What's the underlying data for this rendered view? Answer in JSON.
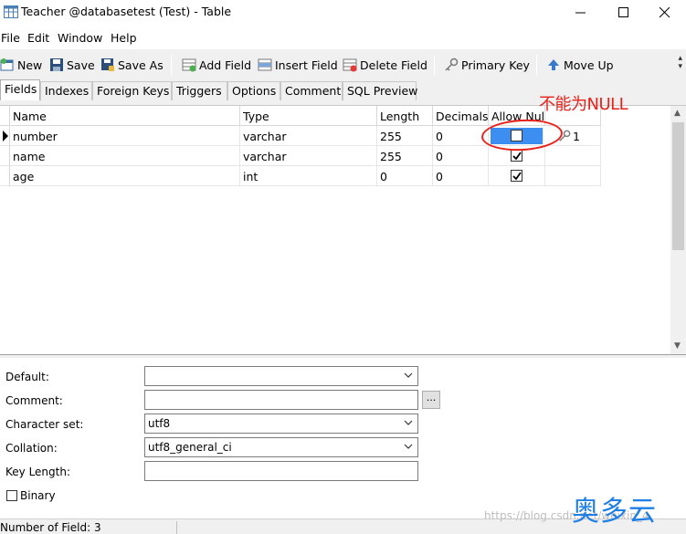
{
  "window": {
    "title": "Teacher @databasetest (Test) - Table"
  },
  "menu": [
    "File",
    "Edit",
    "Window",
    "Help"
  ],
  "toolbar": {
    "new": "New",
    "save": "Save",
    "save_as": "Save As",
    "add_field": "Add Field",
    "insert_field": "Insert Field",
    "delete_field": "Delete Field",
    "primary_key": "Primary Key",
    "move_up": "Move Up"
  },
  "tabs": [
    "Fields",
    "Indexes",
    "Foreign Keys",
    "Triggers",
    "Options",
    "Comment",
    "SQL Preview"
  ],
  "grid": {
    "columns": [
      "Name",
      "Type",
      "Length",
      "Decimals",
      "Allow Null",
      ""
    ],
    "rows": [
      {
        "name": "number",
        "type": "varchar",
        "length": "255",
        "decimals": "0",
        "allow_null": false,
        "key": "1"
      },
      {
        "name": "name",
        "type": "varchar",
        "length": "255",
        "decimals": "0",
        "allow_null": true,
        "key": ""
      },
      {
        "name": "age",
        "type": "int",
        "length": "0",
        "decimals": "0",
        "allow_null": true,
        "key": ""
      }
    ]
  },
  "annotation": "不能为NULL",
  "properties": {
    "default_label": "Default:",
    "default_value": "",
    "comment_label": "Comment:",
    "comment_value": "",
    "charset_label": "Character set:",
    "charset_value": "utf8",
    "collation_label": "Collation:",
    "collation_value": "utf8_general_ci",
    "keylength_label": "Key Length:",
    "keylength_value": "",
    "binary_label": "Binary",
    "ellipsis": "..."
  },
  "status": {
    "text": "Number of Field: 3"
  },
  "watermark": "https://blog.csdn.net/weixin_4",
  "logo": "奥多云",
  "colors": {
    "selection": "#3c8ff0",
    "annotation": "#e8221a",
    "logo": "#1f7fe5"
  }
}
